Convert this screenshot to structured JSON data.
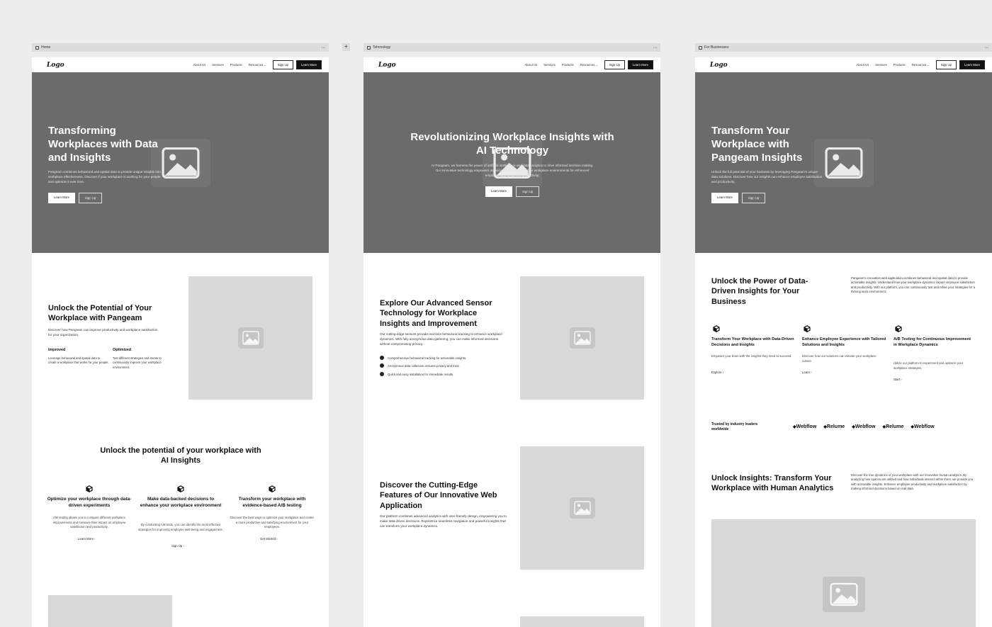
{
  "add_tab_label": "+",
  "nav": {
    "logo": "Logo",
    "links": [
      "About Us",
      "Services",
      "Products",
      "Resources"
    ],
    "signup": "Sign Up",
    "learn_more": "Learn More"
  },
  "frames": [
    {
      "tab_title": "Home",
      "hero": {
        "title": "Transforming Workplaces with Data and Insights",
        "body": "Pangeam combines behavioral and spatial data to provide unique insights into workplace effectiveness. Discover if your workplace is working for your people and optimize it over time.",
        "primary_btn": "Learn More",
        "secondary_btn": "Sign Up"
      },
      "section1": {
        "title": "Unlock the Potential of Your Workplace with Pangeam",
        "body": "Discover how Pangeam can improve productivity and workplace satisfaction for your organization.",
        "col1_title": "Improved",
        "col1_body": "Leverage behavioral and spatial data to create a workplace that works for your people.",
        "col2_title": "Optimized",
        "col2_body": "Test different strategies and iterate to continuously improve your workplace environment."
      },
      "section2": {
        "title": "Unlock the potential of your workplace with AI Insights",
        "features": [
          {
            "title": "Optimize your workplace through data-driven experiments",
            "body": "A/B testing allows you to compare different workplace improvements and measure their impact on employee satisfaction and productivity.",
            "link": "Learn More"
          },
          {
            "title": "Make data-backed decisions to enhance your workplace environment",
            "body": "By conducting A/B tests, you can identify the most effective strategies for improving employee well-being and engagement.",
            "link": "Sign Up"
          },
          {
            "title": "Transform your workplace with evidence-based A/B testing",
            "body": "Discover the best ways to optimize your workplace and create a more productive and satisfying environment for your employees.",
            "link": "Get Started"
          }
        ]
      }
    },
    {
      "tab_title": "Tehcnology",
      "hero": {
        "title": "Revolutionizing Workplace Insights with AI Technology",
        "body": "At Pangeam, we harness the power of artificial intelligence and data analytics to drive informed decision-making. Our innovative technology empowers organizations to optimize their workplace environments for enhanced employee well-being and productivity.",
        "primary_btn": "Learn More",
        "secondary_btn": "Sign Up"
      },
      "section1": {
        "title": "Explore Our Advanced Sensor Technology for Workplace Insights and Improvement",
        "body": "Our cutting-edge sensors provide real-time behavioral tracking to enhance workplace dynamics. With fully anonymous data gathering, you can make informed decisions without compromising privacy.",
        "bullets": [
          "Comprehensive behavioral tracking for actionable insights.",
          "Anonymous data collection ensures privacy and trust.",
          "Quick and easy installation for immediate results."
        ]
      },
      "section2": {
        "title": "Discover the Cutting-Edge Features of Our Innovative Web Application",
        "body": "Our platform combines advanced analytics with user-friendly design, empowering you to make data-driven decisions. Experience seamless navigation and powerful insights that can transform your workplace dynamics."
      }
    },
    {
      "tab_title": "For Businesses",
      "hero": {
        "title": "Transform Your Workplace with Pangeam Insights",
        "body": "Unlock the full potential of your business by leveraging Pangeam's unique data solutions. Discover how our insights can enhance employee satisfaction and productivity.",
        "primary_btn": "Learn More",
        "secondary_btn": "Sign Up"
      },
      "section1": {
        "title": "Unlock the Power of Data-Driven Insights for Your Business",
        "body": "Pangeam's innovative web application combines behavioral and spatial data to provide actionable insights. Understand how your workplace dynamics impact employee satisfaction and productivity. With our platform, you can continuously test and refine your strategies for a thriving work environment.",
        "features": [
          {
            "title": "Transform Your Workplace with Data-Driven Decisions and Insights",
            "body": "Empower your team with the insights they need to succeed.",
            "link": "Explore"
          },
          {
            "title": "Enhance Employee Experience with Tailored Solutions and Insights",
            "body": "Discover how our solutions can elevate your workplace culture.",
            "link": "Learn"
          },
          {
            "title": "A/B Testing for Continuous Improvement in Workplace Dynamics",
            "body": "Utilize our platform to experiment and optimize your workplace strategies.",
            "link": "Start"
          }
        ]
      },
      "trusted": {
        "label": "Trusted by industry leaders worldwide",
        "logos": [
          "Webflow",
          "Relume",
          "Webflow",
          "Relume",
          "Webflow"
        ]
      },
      "section2": {
        "title": "Unlock Insights: Transform Your Workplace with Human Analytics",
        "body": "Discover the true dynamics of your workplace with our innovative human analytics. By analyzing how spaces are utilized and how individuals interact within them, we provide you with actionable insights. Enhance employee productivity and workplace satisfaction by making informed decisions based on real data."
      }
    }
  ]
}
